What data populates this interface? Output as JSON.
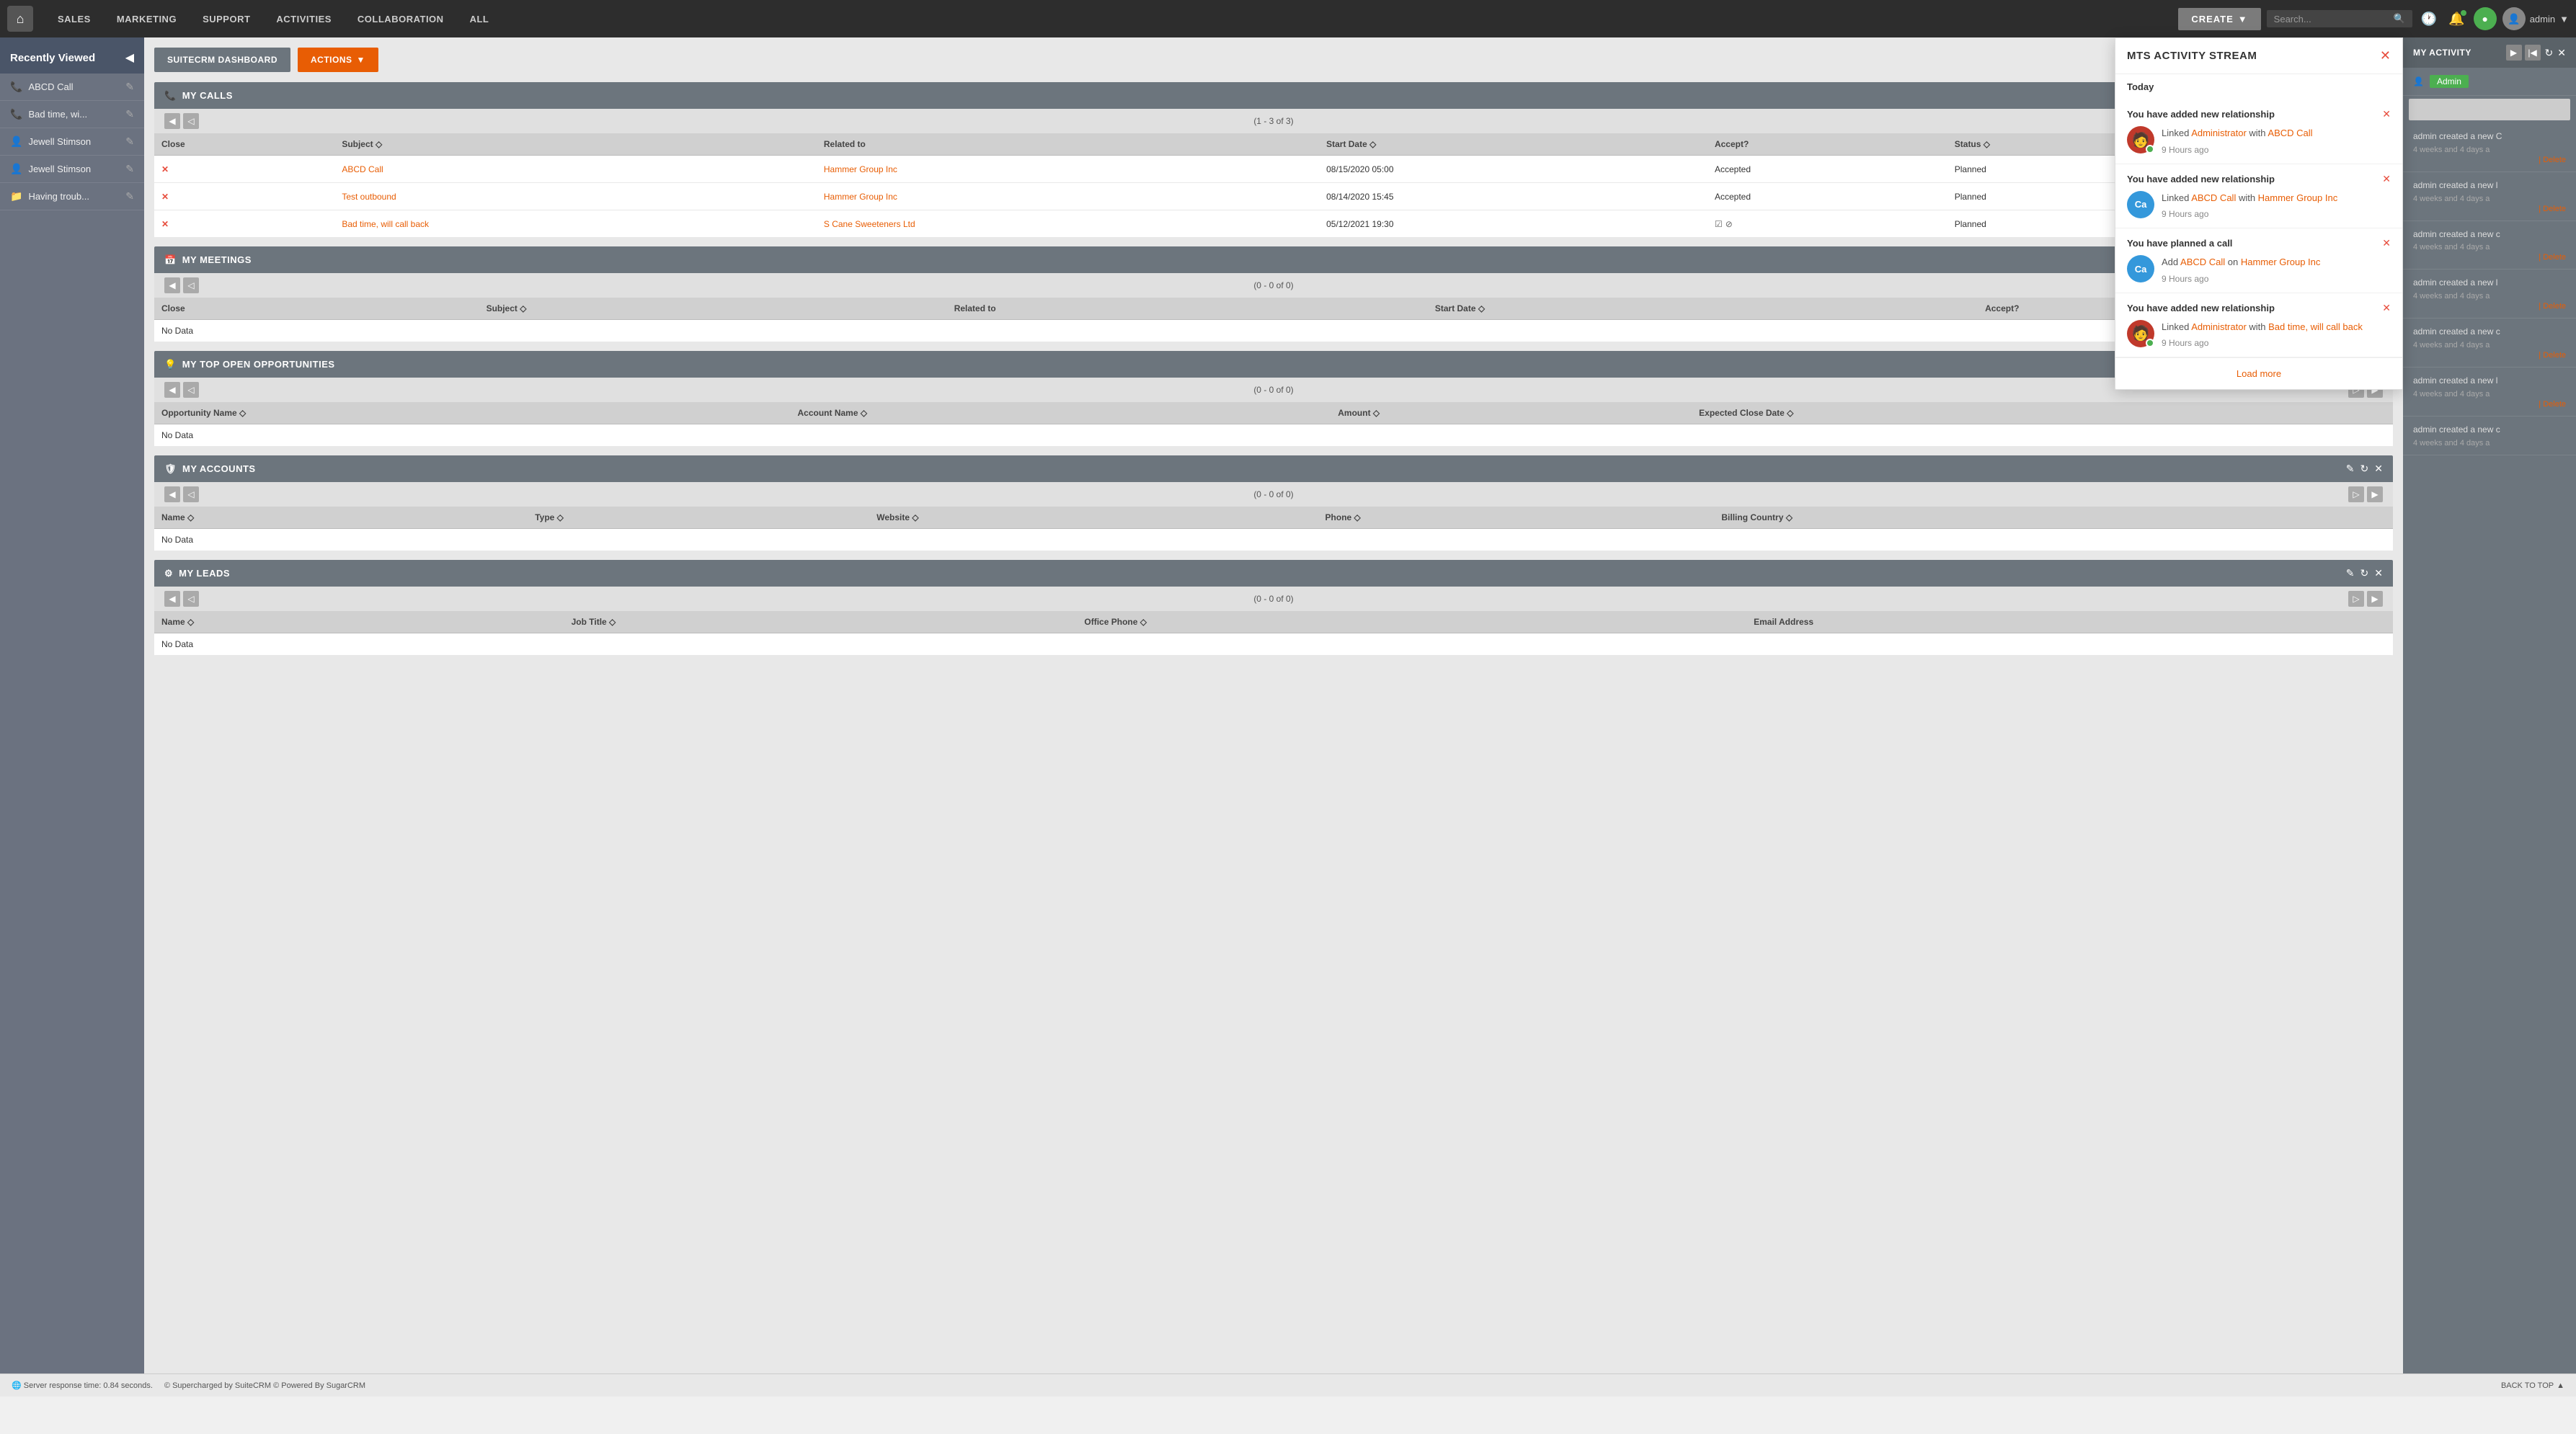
{
  "nav": {
    "logo": "⌂",
    "items": [
      "SALES",
      "MARKETING",
      "SUPPORT",
      "ACTIVITIES",
      "COLLABORATION",
      "ALL"
    ],
    "create_label": "CREATE",
    "search_placeholder": "Search...",
    "admin_label": "admin"
  },
  "sidebar": {
    "title": "Recently Viewed",
    "items": [
      {
        "icon": "📞",
        "text": "ABCD Call"
      },
      {
        "icon": "📞",
        "text": "Bad time, wi..."
      },
      {
        "icon": "👤",
        "text": "Jewell Stimson"
      },
      {
        "icon": "👤",
        "text": "Jewell Stimson"
      },
      {
        "icon": "📁",
        "text": "Having troub..."
      }
    ]
  },
  "dashboard": {
    "suite_btn": "SUITECRM DASHBOARD",
    "actions_btn": "ACTIONS"
  },
  "my_calls": {
    "title": "MY CALLS",
    "count": "(1 - 3 of 3)",
    "columns": [
      "Close",
      "Subject",
      "Related to",
      "Start Date",
      "Accept?",
      "Status"
    ],
    "rows": [
      {
        "subject": "ABCD Call",
        "related": "Hammer Group Inc",
        "start_date": "08/15/2020 05:00",
        "accept": "Accepted",
        "status": "Planned"
      },
      {
        "subject": "Test outbound",
        "related": "Hammer Group Inc",
        "start_date": "08/14/2020 15:45",
        "accept": "Accepted",
        "status": "Planned"
      },
      {
        "subject": "Bad time, will call back",
        "related": "S Cane Sweeteners Ltd",
        "start_date": "05/12/2021 19:30",
        "accept": "",
        "status": "Planned"
      }
    ]
  },
  "my_meetings": {
    "title": "MY MEETINGS",
    "count": "(0 - 0 of 0)",
    "columns": [
      "Close",
      "Subject",
      "Related to",
      "Start Date",
      "Accept?"
    ],
    "no_data": "No Data"
  },
  "my_opportunities": {
    "title": "MY TOP OPEN OPPORTUNITIES",
    "count": "(0 - 0 of 0)",
    "columns": [
      "Opportunity Name",
      "Account Name",
      "Amount",
      "Expected Close Date"
    ],
    "no_data": "No Data"
  },
  "my_accounts": {
    "title": "MY ACCOUNTS",
    "count": "(0 - 0 of 0)",
    "columns": [
      "Name",
      "Type",
      "Website",
      "Phone",
      "Billing Country"
    ],
    "no_data": "No Data"
  },
  "my_leads": {
    "title": "MY LEADS",
    "count": "(0 - 0 of 0)",
    "columns": [
      "Name",
      "Job Title",
      "Office Phone",
      "Email Address"
    ],
    "no_data": "No Data"
  },
  "my_activity": {
    "title": "MY ACTIVITY",
    "label": "Admin",
    "items": [
      {
        "text": "admin created a new C",
        "time": "4 weeks and 4 days a"
      },
      {
        "text": "admin created a new l",
        "time": "4 weeks and 4 days a"
      },
      {
        "text": "admin created a new c",
        "time": "4 weeks and 4 days a"
      },
      {
        "text": "admin created a new l",
        "time": "4 weeks and 4 days a"
      },
      {
        "text": "admin created a new c",
        "time": "4 weeks and 4 days a"
      },
      {
        "text": "admin created a new l",
        "time": "4 weeks and 4 days a"
      },
      {
        "text": "admin created a new c",
        "time": "4 weeks and 4 days a"
      }
    ]
  },
  "mts": {
    "title": "MTS ACTIVITY STREAM",
    "today_label": "Today",
    "items": [
      {
        "id": 1,
        "title": "You have added new relationship",
        "avatar_type": "admin",
        "avatar_text": "🧑",
        "green_dot": true,
        "text_parts": [
          "Linked ",
          "Administrator",
          " with ",
          "ABCD Call"
        ],
        "link1": "Administrator",
        "link2": "ABCD Call",
        "time": "9 Hours ago"
      },
      {
        "id": 2,
        "title": "You have added new relationship",
        "avatar_type": "ca",
        "avatar_text": "Ca",
        "green_dot": false,
        "text_parts": [
          "Linked ",
          "ABCD Call",
          " with ",
          "Hammer Group Inc"
        ],
        "link1": "ABCD Call",
        "link2": "Hammer Group Inc",
        "time": "9 Hours ago"
      },
      {
        "id": 3,
        "title": "You have planned a call",
        "avatar_type": "ca",
        "avatar_text": "Ca",
        "green_dot": false,
        "text_parts": [
          "Add ",
          "ABCD Call",
          " on ",
          "Hammer Group Inc"
        ],
        "link1": "ABCD Call",
        "link2": "Hammer Group Inc",
        "time": "9 Hours ago"
      },
      {
        "id": 4,
        "title": "You have added new relationship",
        "avatar_type": "admin",
        "avatar_text": "🧑",
        "green_dot": true,
        "text_parts": [
          "Linked ",
          "Administrator",
          " with ",
          "Bad time, will call back"
        ],
        "link1": "Administrator",
        "link2": "Bad time, will call back",
        "time": "9 Hours ago"
      }
    ],
    "load_more": "Load more"
  },
  "footer": {
    "server_info": "Server response time: 0.84 seconds.",
    "powered_by": "© Supercharged by SuiteCRM  © Powered By SugarCRM",
    "back_to_top": "BACK TO TOP"
  }
}
